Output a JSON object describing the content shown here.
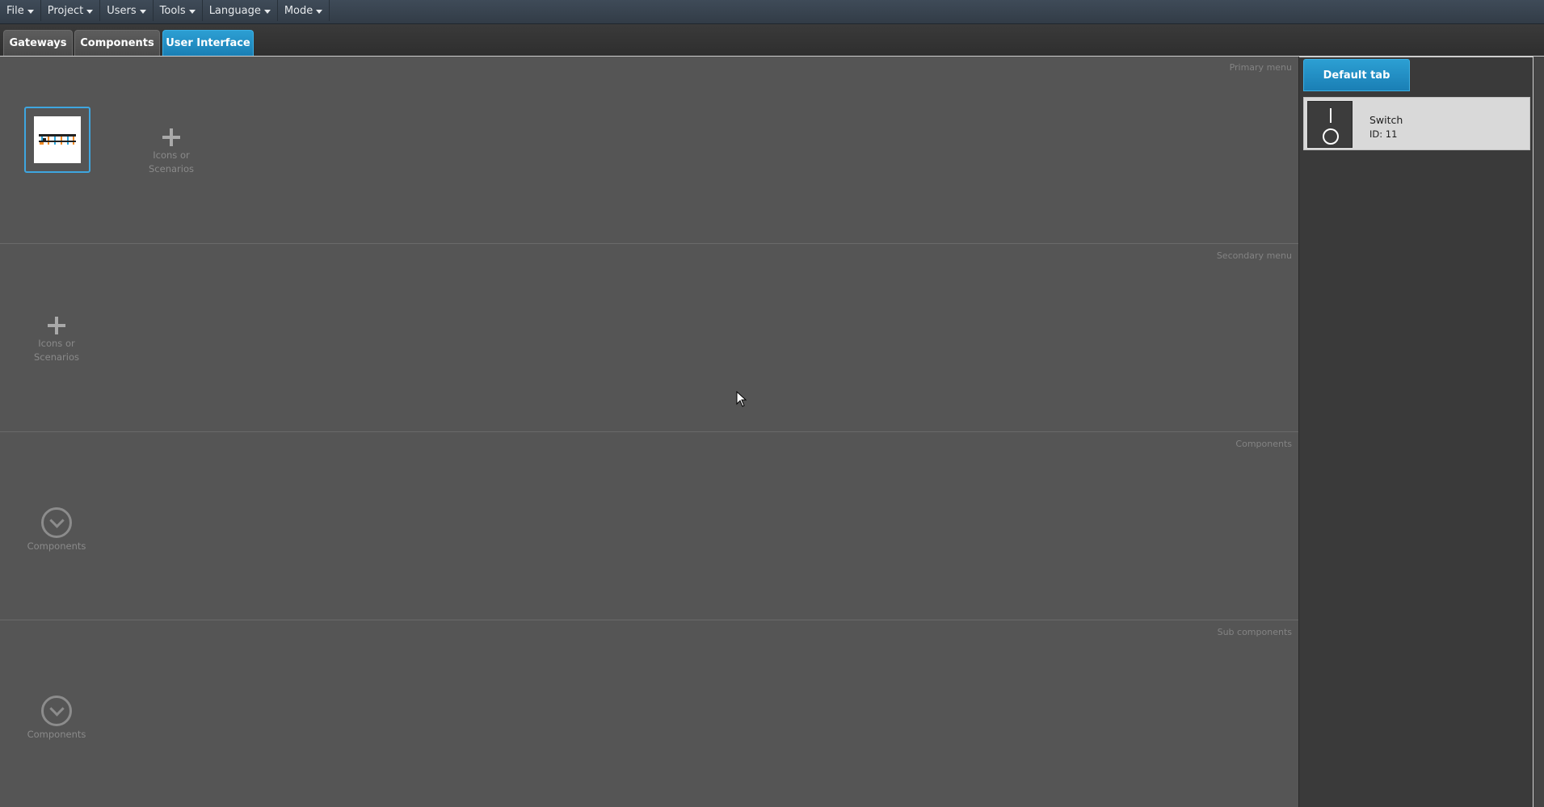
{
  "menubar": {
    "items": [
      {
        "label": "File"
      },
      {
        "label": "Project"
      },
      {
        "label": "Users"
      },
      {
        "label": "Tools"
      },
      {
        "label": "Language"
      },
      {
        "label": "Mode"
      }
    ]
  },
  "tabs": {
    "gateways": "Gateways",
    "components": "Components",
    "user_interface": "User Interface",
    "active": "User Interface"
  },
  "sections": {
    "primary": {
      "title": "Primary menu",
      "add_label": "Icons or Scenarios"
    },
    "secondary": {
      "title": "Secondary menu",
      "add_label": "Icons or Scenarios"
    },
    "components": {
      "title": "Components",
      "slot_label": "Components"
    },
    "sub_components": {
      "title": "Sub components",
      "slot_label": "Components"
    }
  },
  "right_panel": {
    "tab_label": "Default tab",
    "component": {
      "name": "Switch",
      "id_text": "ID: 11",
      "icon": "power-switch-icon"
    }
  },
  "colors": {
    "accent": "#1a8fc8",
    "background": "#555555",
    "menubar": "#38434f"
  }
}
